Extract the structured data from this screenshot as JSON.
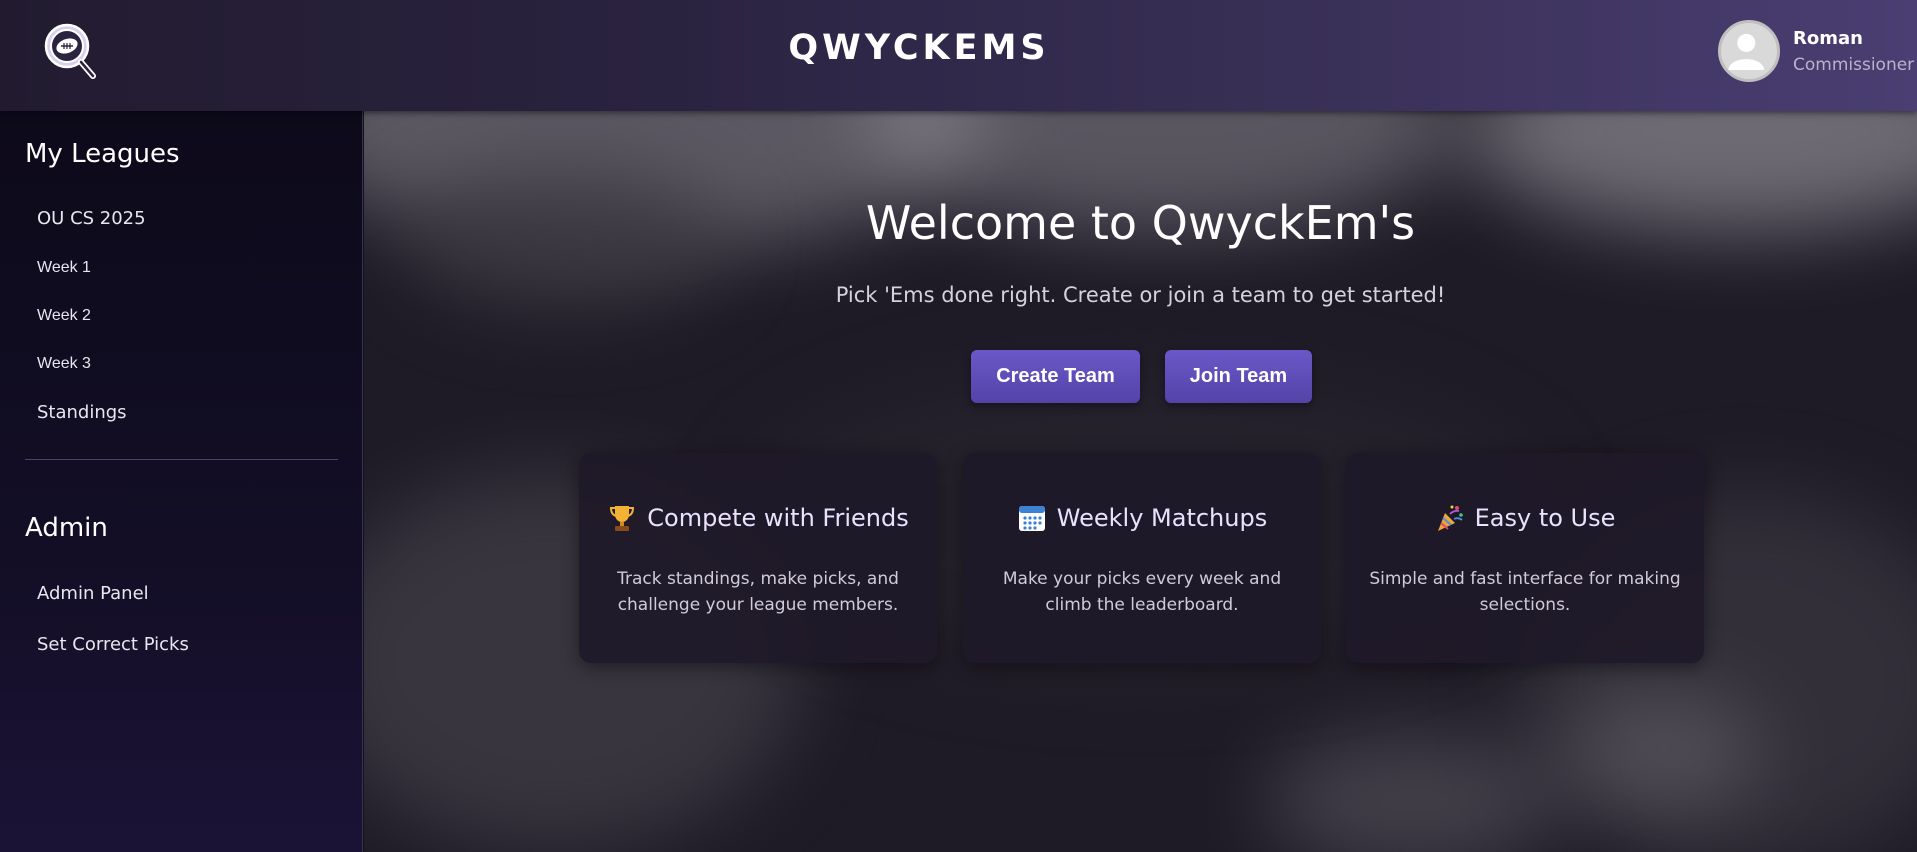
{
  "header": {
    "app_title": "QWYCKEMS",
    "logo_icon": "football-magnifier-logo",
    "user": {
      "name": "Roman",
      "role": "Commissioner",
      "avatar_icon": "user-avatar-icon"
    }
  },
  "sidebar": {
    "my_leagues": {
      "title": "My Leagues",
      "items": [
        {
          "label": "OU CS 2025"
        },
        {
          "label": "Week 1"
        },
        {
          "label": "Week 2"
        },
        {
          "label": "Week 3"
        },
        {
          "label": "Standings"
        }
      ]
    },
    "admin": {
      "title": "Admin",
      "items": [
        {
          "label": "Admin Panel"
        },
        {
          "label": "Set Correct Picks"
        }
      ]
    }
  },
  "main": {
    "title": "Welcome to QwyckEm's",
    "subtitle": "Pick 'Ems done right. Create or join a team to get started!",
    "buttons": {
      "create": "Create Team",
      "join": "Join Team"
    },
    "cards": [
      {
        "icon": "trophy-icon",
        "title": "Compete with Friends",
        "desc": "Track standings, make picks, and challenge your league members."
      },
      {
        "icon": "calendar-icon",
        "title": "Weekly Matchups",
        "desc": "Make your picks every week and climb the leaderboard."
      },
      {
        "icon": "party-popper-icon",
        "title": "Easy to Use",
        "desc": "Simple and fast interface for making selections."
      }
    ]
  },
  "colors": {
    "accent": "#6b58c8",
    "sidebar_bg": "#0d0a1a",
    "header_bg": "#2a2340"
  }
}
